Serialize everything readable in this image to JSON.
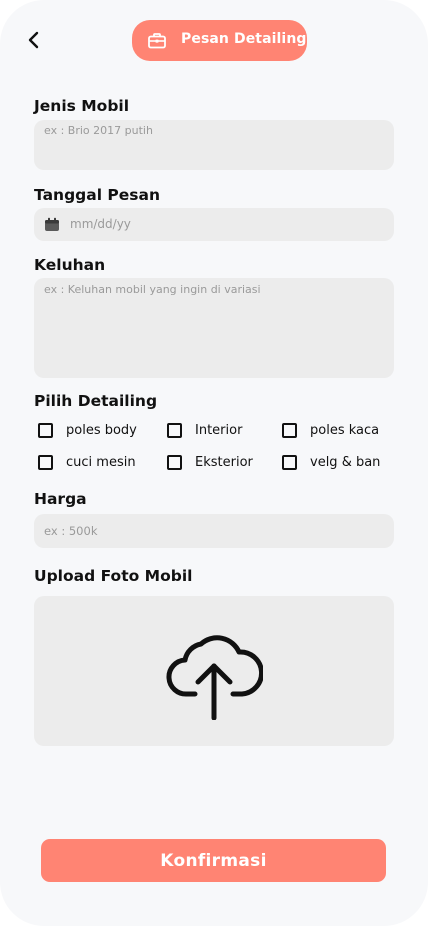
{
  "header": {
    "title": "Pesan Detailing",
    "back_icon": "chevron-left-icon",
    "title_icon": "briefcase-icon",
    "accent_color": "#ff8473"
  },
  "form": {
    "jenis_mobil": {
      "label": "Jenis Mobil",
      "placeholder": "ex : Brio  2017 putih"
    },
    "tanggal_pesan": {
      "label": "Tanggal Pesan",
      "placeholder": "mm/dd/yy",
      "icon": "calendar-icon"
    },
    "keluhan": {
      "label": "Keluhan",
      "placeholder": "ex : Keluhan mobil yang ingin di variasi"
    },
    "pilih_detailing": {
      "label": "Pilih Detailing",
      "options": [
        {
          "label": "poles body",
          "checked": false
        },
        {
          "label": "Interior",
          "checked": false
        },
        {
          "label": "poles kaca",
          "checked": false
        },
        {
          "label": "cuci mesin",
          "checked": false
        },
        {
          "label": "Eksterior",
          "checked": false
        },
        {
          "label": "velg & ban",
          "checked": false
        }
      ]
    },
    "harga": {
      "label": "Harga",
      "placeholder": "ex : 500k"
    },
    "upload_foto": {
      "label": "Upload Foto Mobil",
      "icon": "cloud-upload-icon"
    }
  },
  "footer": {
    "confirm_label": "Konfirmasi"
  }
}
